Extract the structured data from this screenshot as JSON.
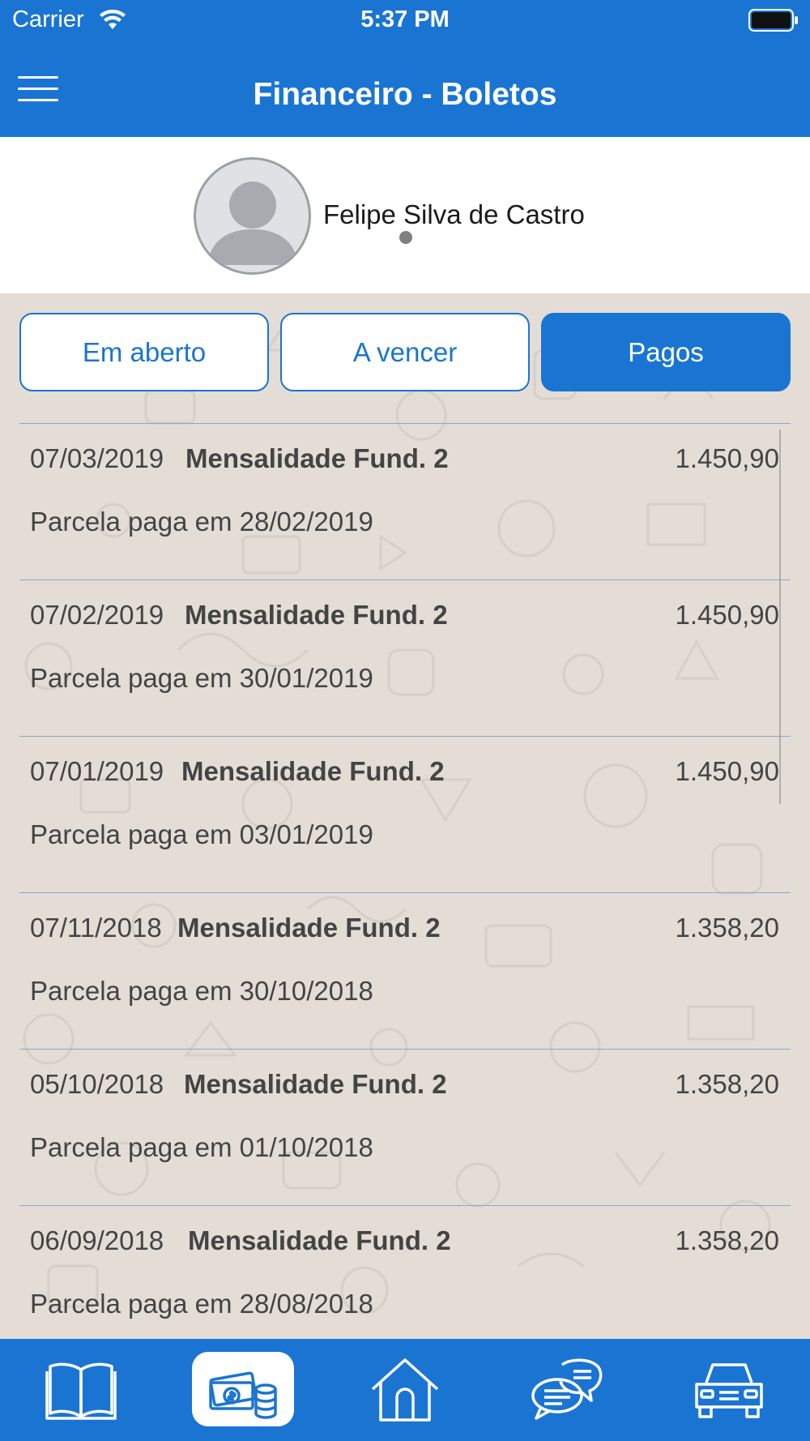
{
  "status_bar": {
    "carrier": "Carrier",
    "time": "5:37 PM"
  },
  "header": {
    "title": "Financeiro - Boletos"
  },
  "profile": {
    "name": "Felipe Silva de Castro"
  },
  "filters": {
    "items": [
      "Em aberto",
      "A vencer",
      "Pagos"
    ],
    "active": "Pagos"
  },
  "boletos": [
    {
      "date": "07/03/2019",
      "description": "Mensalidade Fund. 2",
      "value": "1.450,90",
      "status": "Parcela paga em 28/02/2019"
    },
    {
      "date": "07/02/2019",
      "description": "Mensalidade Fund. 2",
      "value": "1.450,90",
      "status": "Parcela paga em 30/01/2019"
    },
    {
      "date": "07/01/2019",
      "description": "Mensalidade Fund. 2",
      "value": "1.450,90",
      "status": "Parcela paga em 03/01/2019"
    },
    {
      "date": "07/11/2018",
      "description": "Mensalidade Fund. 2",
      "value": "1.358,20",
      "status": "Parcela paga em 30/10/2018"
    },
    {
      "date": "05/10/2018",
      "description": "Mensalidade Fund. 2",
      "value": "1.358,20",
      "status": "Parcela paga em 01/10/2018"
    },
    {
      "date": "06/09/2018",
      "description": "Mensalidade Fund. 2",
      "value": "1.358,20",
      "status": "Parcela paga em 28/08/2018"
    }
  ],
  "tab_bar": {
    "items": [
      {
        "icon": "book-icon"
      },
      {
        "icon": "money-icon",
        "active": true
      },
      {
        "icon": "home-icon"
      },
      {
        "icon": "chat-icon"
      },
      {
        "icon": "car-icon"
      }
    ]
  },
  "colors": {
    "primary": "#1a75d2",
    "background": "#e3ddd6",
    "text": "#444444",
    "divider": "#8fa6c8"
  }
}
